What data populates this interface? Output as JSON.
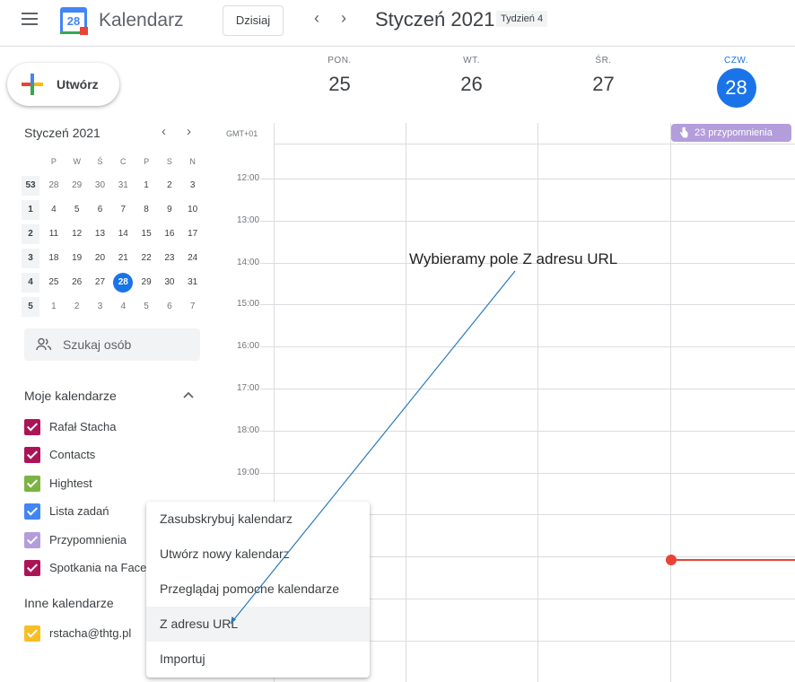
{
  "header": {
    "app_title": "Kalendarz",
    "logo_day": "28",
    "today_label": "Dzisiaj",
    "period_label": "Styczeń 2021",
    "week_badge": "Tydzień 4",
    "prev_glyph": "‹",
    "next_glyph": "›"
  },
  "create_button": {
    "label": "Utwórz"
  },
  "mini_calendar": {
    "title": "Styczeń 2021",
    "prev_glyph": "‹",
    "next_glyph": "›",
    "weekday_headers": [
      "P",
      "W",
      "Ś",
      "C",
      "P",
      "S",
      "N"
    ],
    "weeks": [
      {
        "wk": "53",
        "days": [
          "28",
          "29",
          "30",
          "31",
          "1",
          "2",
          "3"
        ]
      },
      {
        "wk": "1",
        "days": [
          "4",
          "5",
          "6",
          "7",
          "8",
          "9",
          "10"
        ]
      },
      {
        "wk": "2",
        "days": [
          "11",
          "12",
          "13",
          "14",
          "15",
          "16",
          "17"
        ]
      },
      {
        "wk": "3",
        "days": [
          "18",
          "19",
          "20",
          "21",
          "22",
          "23",
          "24"
        ]
      },
      {
        "wk": "4",
        "days": [
          "25",
          "26",
          "27",
          "28",
          "29",
          "30",
          "31"
        ]
      },
      {
        "wk": "5",
        "days": [
          "1",
          "2",
          "3",
          "4",
          "5",
          "6",
          "7"
        ]
      }
    ]
  },
  "search_people": {
    "placeholder": "Szukaj osób"
  },
  "my_calendars": {
    "title": "Moje kalendarze",
    "items": [
      {
        "label": "Rafał Stacha",
        "color": "#ad1457"
      },
      {
        "label": "Contacts",
        "color": "#ad1457"
      },
      {
        "label": "Hightest",
        "color": "#7cb342"
      },
      {
        "label": "Lista zadań",
        "color": "#4285f4"
      },
      {
        "label": "Przypomnienia",
        "color": "#b39ddb"
      },
      {
        "label": "Spotkania na Face",
        "color": "#ad1457"
      }
    ]
  },
  "other_calendars": {
    "title": "Inne kalendarze",
    "items": [
      {
        "label": "rstacha@thtg.pl",
        "color": "#f6bf26"
      }
    ]
  },
  "week_view": {
    "timezone": "GMT+01",
    "days": [
      {
        "dow": "PON.",
        "num": "25"
      },
      {
        "dow": "WT.",
        "num": "26"
      },
      {
        "dow": "ŚR.",
        "num": "27"
      },
      {
        "dow": "CZW.",
        "num": "28"
      }
    ],
    "hours": [
      "12:00",
      "13:00",
      "14:00",
      "15:00",
      "16:00",
      "17:00",
      "18:00",
      "19:00"
    ],
    "reminders_chip": "23 przypomnienia"
  },
  "annotation": "Wybieramy pole Z adresu URL",
  "add_calendar_menu": {
    "items": [
      "Zasubskrybuj kalendarz",
      "Utwórz nowy kalendarz",
      "Przeglądaj pomocne kalendarze",
      "Z adresu URL",
      "Importuj"
    ],
    "highlighted": "Z adresu URL"
  },
  "colors": {
    "accent": "#1a73e8",
    "now_indicator": "#ea4335",
    "reminders": "#b39ddb"
  }
}
